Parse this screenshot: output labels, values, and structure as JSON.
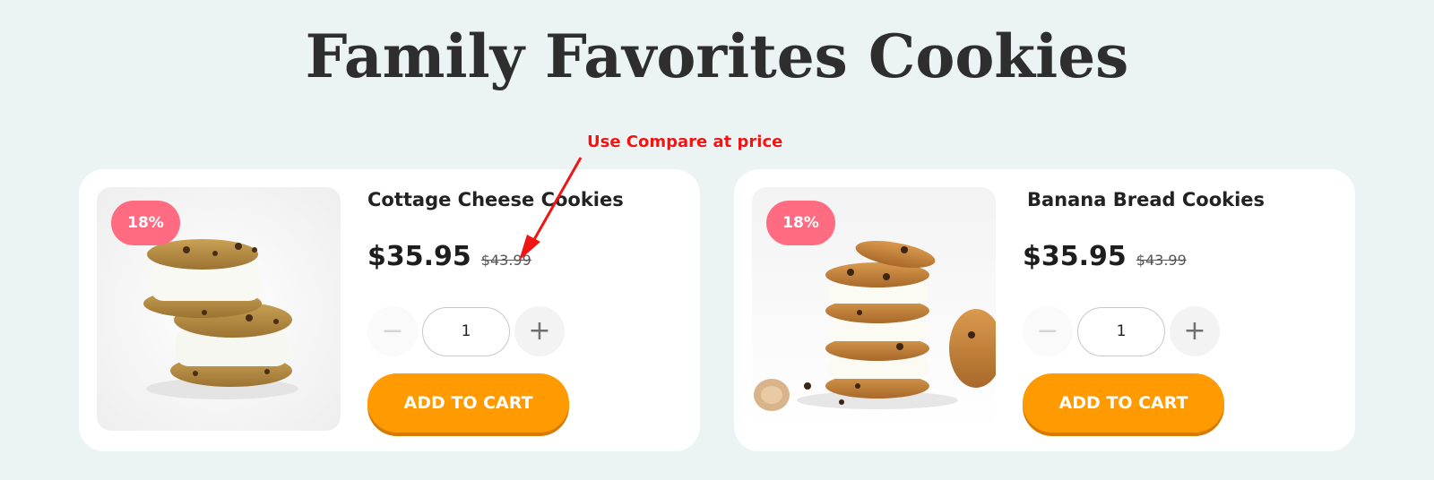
{
  "page": {
    "title": "Family Favorites Cookies"
  },
  "annotation": {
    "text": "Use Compare at price",
    "color": "#f21313"
  },
  "colors": {
    "background": "#ebf4f3",
    "card": "#ffffff",
    "badge": "#ff6b81",
    "button": "#ff9a00",
    "button_shadow": "#d77a00"
  },
  "products": [
    {
      "name": "Cottage Cheese Cookies",
      "badge": "18%",
      "price": "$35.95",
      "compare_price": "$43.99",
      "quantity": "1",
      "minus_icon": "minus-icon",
      "plus_icon": "plus-icon",
      "minus_label": "−",
      "plus_label": "+",
      "button_label": "ADD TO CART"
    },
    {
      "name": "Banana Bread Cookies",
      "badge": "18%",
      "price": "$35.95",
      "compare_price": "$43.99",
      "quantity": "1",
      "minus_icon": "minus-icon",
      "plus_icon": "plus-icon",
      "minus_label": "−",
      "plus_label": "+",
      "button_label": "ADD TO CART"
    }
  ]
}
